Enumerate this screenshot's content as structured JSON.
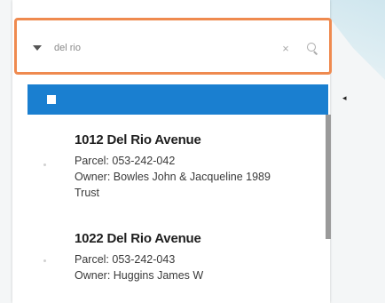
{
  "search": {
    "query": "del rio"
  },
  "map": {
    "collapse_glyph": "◂"
  },
  "results": [
    {
      "address": "1012 Del Rio Avenue",
      "parcel": "Parcel: 053-242-042",
      "owner": "Owner: Bowles John & Jacqueline 1989",
      "owner_cont": "Trust"
    },
    {
      "address": "1022 Del Rio Avenue",
      "parcel": "Parcel: 053-242-043",
      "owner": "Owner: Huggins James W"
    }
  ],
  "colors": {
    "highlight_border": "#ef8a4f",
    "header_bar": "#1a7fd0"
  },
  "icons": {
    "dropdown": "triangle-down-icon",
    "clear": "close-icon",
    "search": "search-icon",
    "collapse": "triangle-left-icon"
  }
}
